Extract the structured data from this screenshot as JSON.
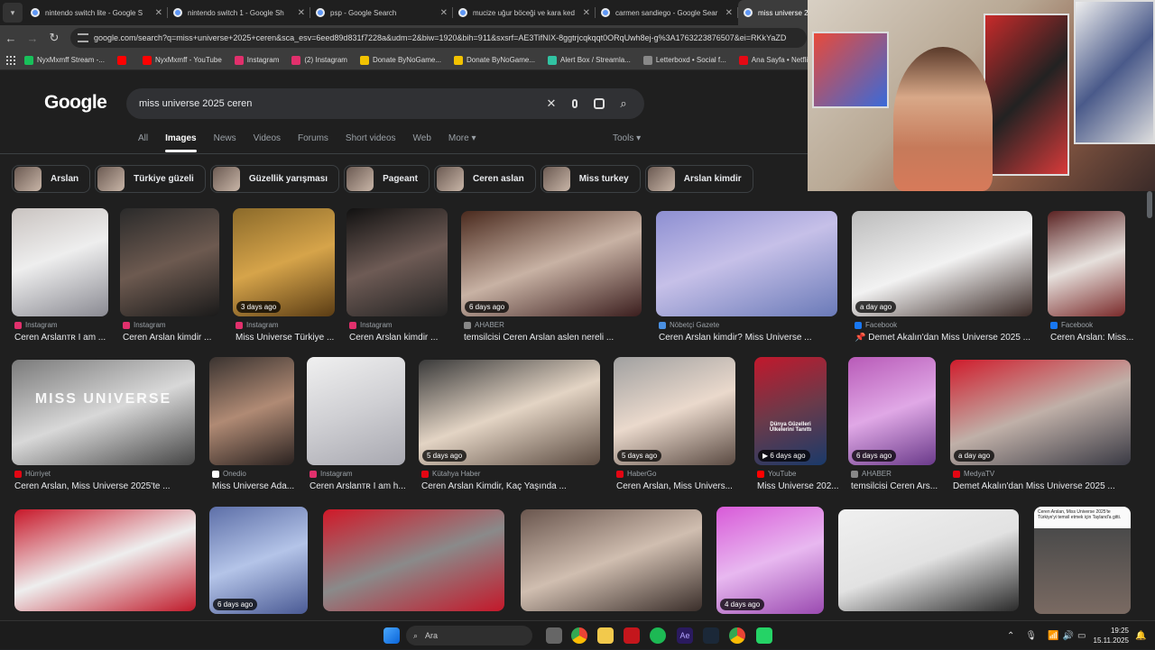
{
  "browser": {
    "tabs": [
      {
        "title": "nintendo switch lite - Google S",
        "active": false
      },
      {
        "title": "nintendo switch 1 - Google Sh",
        "active": false
      },
      {
        "title": "psp - Google Search",
        "active": false
      },
      {
        "title": "mucize uğur böceği ve kara ked",
        "active": false
      },
      {
        "title": "carmen sandiego - Google Sear",
        "active": false
      },
      {
        "title": "miss universe 2",
        "active": true
      }
    ],
    "url": "google.com/search?q=miss+universe+2025+ceren&sca_esv=6eed89d831f7228a&udm=2&biw=1920&bih=911&sxsrf=AE3TifNIX-8ggtrjcqkqqt0ORqUwh8ej-g%3A1763223876507&ei=RKkYaZD",
    "bookmarks": [
      {
        "label": "NyxMxmff Stream -...",
        "color": "#18c05a"
      },
      {
        "label": "",
        "color": "#ff0000"
      },
      {
        "label": "NyxMxmff - YouTube",
        "color": "#ff0000"
      },
      {
        "label": "Instagram",
        "color": "#e1306c"
      },
      {
        "label": "(2) Instagram",
        "color": "#e1306c"
      },
      {
        "label": "Donate ByNoGame...",
        "color": "#f2c200"
      },
      {
        "label": "Donate ByNoGame...",
        "color": "#f2c200"
      },
      {
        "label": "Alert Box / Streamla...",
        "color": "#31c3a2"
      },
      {
        "label": "Letterboxd • Social f...",
        "color": "#888888"
      },
      {
        "label": "Ana Sayfa • Netflix",
        "color": "#e50914"
      }
    ]
  },
  "google": {
    "logo": "Google",
    "query": "miss universe 2025 ceren",
    "tabs": [
      "All",
      "Images",
      "News",
      "Videos",
      "Forums",
      "Short videos",
      "Web",
      "More"
    ],
    "selected_tab": "Images",
    "tools": "Tools",
    "chips": [
      "Arslan",
      "Türkiye güzeli",
      "Güzellik yarışması",
      "Pageant",
      "Ceren aslan",
      "Miss turkey",
      "Arslan kimdir"
    ],
    "row1": [
      {
        "source": "Instagram",
        "caption": "Ceren Arslanᴛʀ I am ...",
        "badge": "",
        "icon_color": "#e1306c"
      },
      {
        "source": "Instagram",
        "caption": "Ceren Arslan kimdir ...",
        "badge": "",
        "icon_color": "#e1306c"
      },
      {
        "source": "Instagram",
        "caption": "Miss Universe Türkiye ...",
        "badge": "3 days ago",
        "icon_color": "#e1306c"
      },
      {
        "source": "Instagram",
        "caption": "Ceren Arslan kimdir ...",
        "badge": "",
        "icon_color": "#e1306c"
      },
      {
        "source": "AHABER",
        "caption": "temsilcisi Ceren Arslan aslen nereli ...",
        "badge": "6 days ago",
        "icon_color": "#888888"
      },
      {
        "source": "Nöbetçi Gazete",
        "caption": "Ceren Arslan kimdir? Miss Universe ...",
        "badge": "",
        "icon_color": "#4a90e2"
      },
      {
        "source": "Facebook",
        "caption": "📌 Demet Akalın'dan Miss Universe 2025 ...",
        "badge": "a day ago",
        "icon_color": "#1877f2"
      },
      {
        "source": "Facebook",
        "caption": "Ceren Arslan: Miss...",
        "badge": "",
        "icon_color": "#1877f2"
      }
    ],
    "row2": [
      {
        "source": "Hürriyet",
        "caption": "Ceren Arslan, Miss Universe 2025'te ...",
        "badge": "",
        "icon_color": "#e30613"
      },
      {
        "source": "Onedio",
        "caption": "Miss Universe Ada...",
        "badge": "",
        "icon_color": "#ffffff"
      },
      {
        "source": "Instagram",
        "caption": "Ceren Arslanᴛʀ I am h...",
        "badge": "",
        "icon_color": "#e1306c"
      },
      {
        "source": "Kütahya Haber",
        "caption": "Ceren Arslan Kimdir, Kaç Yaşında ...",
        "badge": "5 days ago",
        "icon_color": "#e30613"
      },
      {
        "source": "HaberGo",
        "caption": "Ceren Arslan, Miss Univers...",
        "badge": "5 days ago",
        "icon_color": "#e30613"
      },
      {
        "source": "YouTube",
        "caption": "Miss Universe 202...",
        "badge": "▶ 6 days ago",
        "icon_color": "#ff0000"
      },
      {
        "source": "AHABER",
        "caption": "temsilcisi Ceren Ars...",
        "badge": "6 days ago",
        "icon_color": "#888888"
      },
      {
        "source": "MedyaTV",
        "caption": "Demet Akalın'dan Miss Universe 2025 ...",
        "badge": "a day ago",
        "icon_color": "#e30613"
      }
    ],
    "row3_badges": [
      "",
      "6 days ago",
      "",
      "",
      "4 days ago",
      "",
      ""
    ],
    "misc_text": {
      "miss_universe_logo": "MISS UNIVERSE",
      "dunya_text": "Dünya Güzelleri Ülkelerini Tanıttı",
      "last_card_text": "Ceren Arslan, Miss Universe 2025'te Türkiye'yi temsil etmek için Tayland'a gitti."
    }
  },
  "taskbar": {
    "search_label": "Ara",
    "time": "19:25",
    "date": "15.11.2025"
  }
}
